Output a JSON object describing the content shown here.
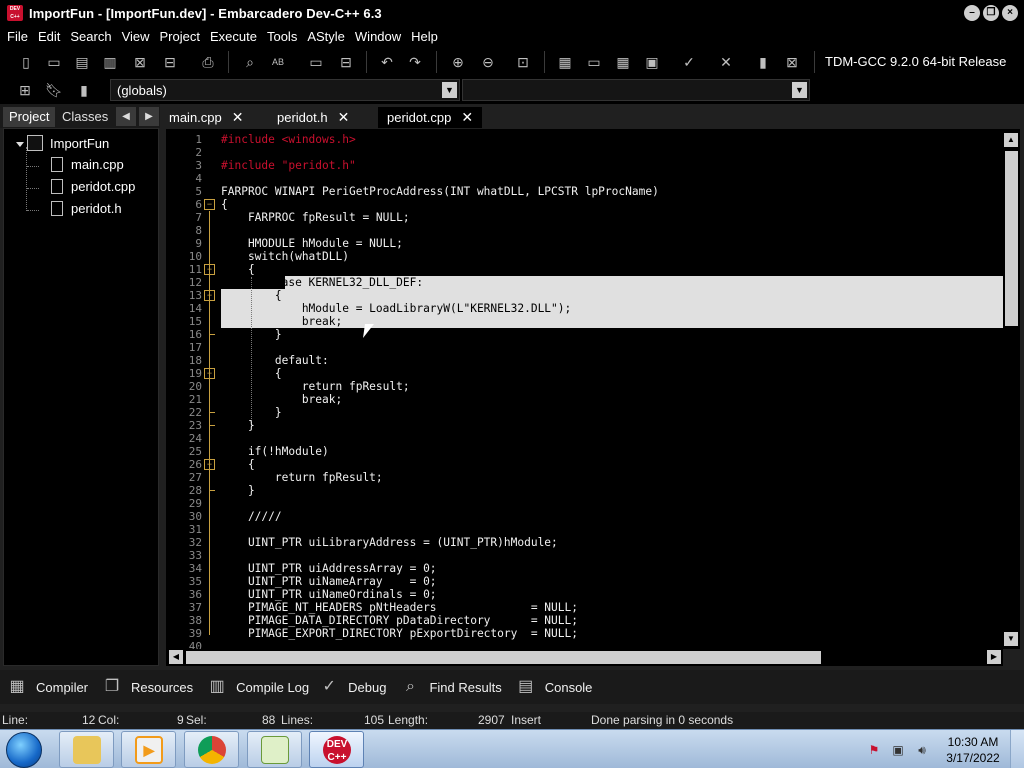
{
  "window": {
    "title": "ImportFun - [ImportFun.dev] - Embarcadero Dev-C++ 6.3",
    "app_icon_text": "DEV C++"
  },
  "menu": [
    "File",
    "Edit",
    "Search",
    "View",
    "Project",
    "Execute",
    "Tools",
    "AStyle",
    "Window",
    "Help"
  ],
  "toolbar": {
    "compiler": "TDM-GCC 9.2.0 64-bit Release",
    "scope": "(globals)"
  },
  "left_panel": {
    "tabs": [
      "Project",
      "Classes"
    ],
    "tree": {
      "project": "ImportFun",
      "files": [
        "main.cpp",
        "peridot.cpp",
        "peridot.h"
      ]
    }
  },
  "editor": {
    "tabs": [
      "main.cpp",
      "peridot.h",
      "peridot.cpp"
    ],
    "active_tab": "peridot.cpp",
    "lines": [
      "#include <windows.h>",
      "",
      "#include \"peridot.h\"",
      "",
      "FARPROC WINAPI PeriGetProcAddress(INT whatDLL, LPCSTR lpProcName)",
      "{",
      "    FARPROC fpResult = NULL;",
      "",
      "    HMODULE hModule = NULL;",
      "    switch(whatDLL)",
      "    {",
      "        case KERNEL32_DLL_DEF:",
      "        {",
      "            hModule = LoadLibraryW(L\"KERNEL32.DLL\");",
      "            break;",
      "        }",
      "",
      "        default:",
      "        {",
      "            return fpResult;",
      "            break;",
      "        }",
      "    }",
      "",
      "    if(!hModule)",
      "    {",
      "        return fpResult;",
      "    }",
      "",
      "    /////",
      "",
      "    UINT_PTR uiLibraryAddress = (UINT_PTR)hModule;",
      "",
      "    UINT_PTR uiAddressArray = 0;",
      "    UINT_PTR uiNameArray    = 0;",
      "    UINT_PTR uiNameOrdinals = 0;",
      "    PIMAGE_NT_HEADERS pNtHeaders              = NULL;",
      "    PIMAGE_DATA_DIRECTORY pDataDirectory      = NULL;",
      "    PIMAGE_EXPORT_DIRECTORY pExportDirectory  = NULL;",
      ""
    ],
    "line_numbers": [
      "1",
      "2",
      "3",
      "4",
      "5",
      "6",
      "7",
      "8",
      "9",
      "10",
      "11",
      "12",
      "13",
      "14",
      "15",
      "16",
      "17",
      "18",
      "19",
      "20",
      "21",
      "22",
      "23",
      "24",
      "25",
      "26",
      "27",
      "28",
      "29",
      "30",
      "31",
      "32",
      "33",
      "34",
      "35",
      "36",
      "37",
      "38",
      "39",
      "40"
    ]
  },
  "bottom_tabs": [
    "Compiler",
    "Resources",
    "Compile Log",
    "Debug",
    "Find Results",
    "Console"
  ],
  "status": {
    "line_label": "Line:",
    "line_value": "12",
    "col_label": "Col:",
    "col_value": "9",
    "sel_label": "Sel:",
    "sel_value": "88",
    "lines_label": "Lines:",
    "lines_value": "105",
    "length_label": "Length:",
    "length_value": "2907",
    "mode": "Insert",
    "message": "Done parsing in 0 seconds"
  },
  "taskbar": {
    "time": "10:30 AM",
    "date": "3/17/2022"
  },
  "colors": {
    "accent_red": "#c8102e",
    "selection": "#e0e0e0",
    "background": "#000000"
  }
}
